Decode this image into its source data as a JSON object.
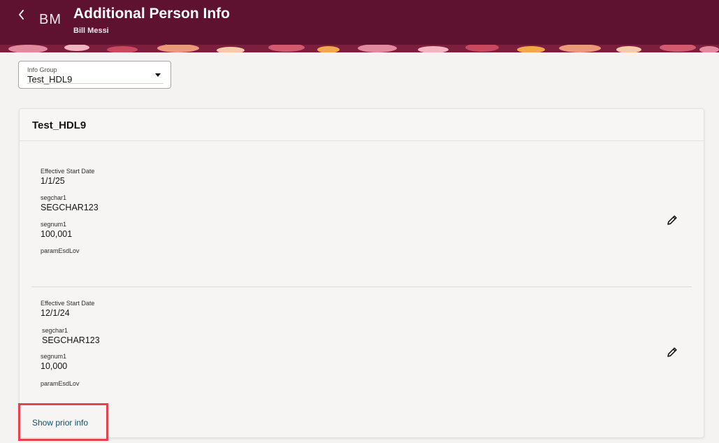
{
  "header": {
    "title": "Additional Person Info",
    "person_name": "Bill Messi",
    "initials": "BM",
    "back_icon": "chevron-left-icon",
    "background_color": "#5f1230"
  },
  "info_group": {
    "label": "Info Group",
    "value": "Test_HDL9",
    "caret_icon": "caret-down-icon"
  },
  "card": {
    "title": "Test_HDL9",
    "records": [
      {
        "effective_start_date_label": "Effective Start Date",
        "effective_start_date": "1/1/25",
        "segchar1_label": "segchar1",
        "segchar1": "SEGCHAR123",
        "segnum1_label": "segnum1",
        "segnum1": "100,001",
        "param_label": "paramEsdLov",
        "edit_icon": "pencil-icon"
      },
      {
        "effective_start_date_label": "Effective Start Date",
        "effective_start_date": "12/1/24",
        "segchar1_label": "segchar1",
        "segchar1": "SEGCHAR123",
        "segnum1_label": "segnum1",
        "segnum1": "10,000",
        "param_label": "paramEsdLov",
        "edit_icon": "pencil-icon"
      }
    ],
    "show_prior_label": "Show prior info",
    "link_color": "#0d4f6b",
    "highlight_color": "#e5414f"
  }
}
